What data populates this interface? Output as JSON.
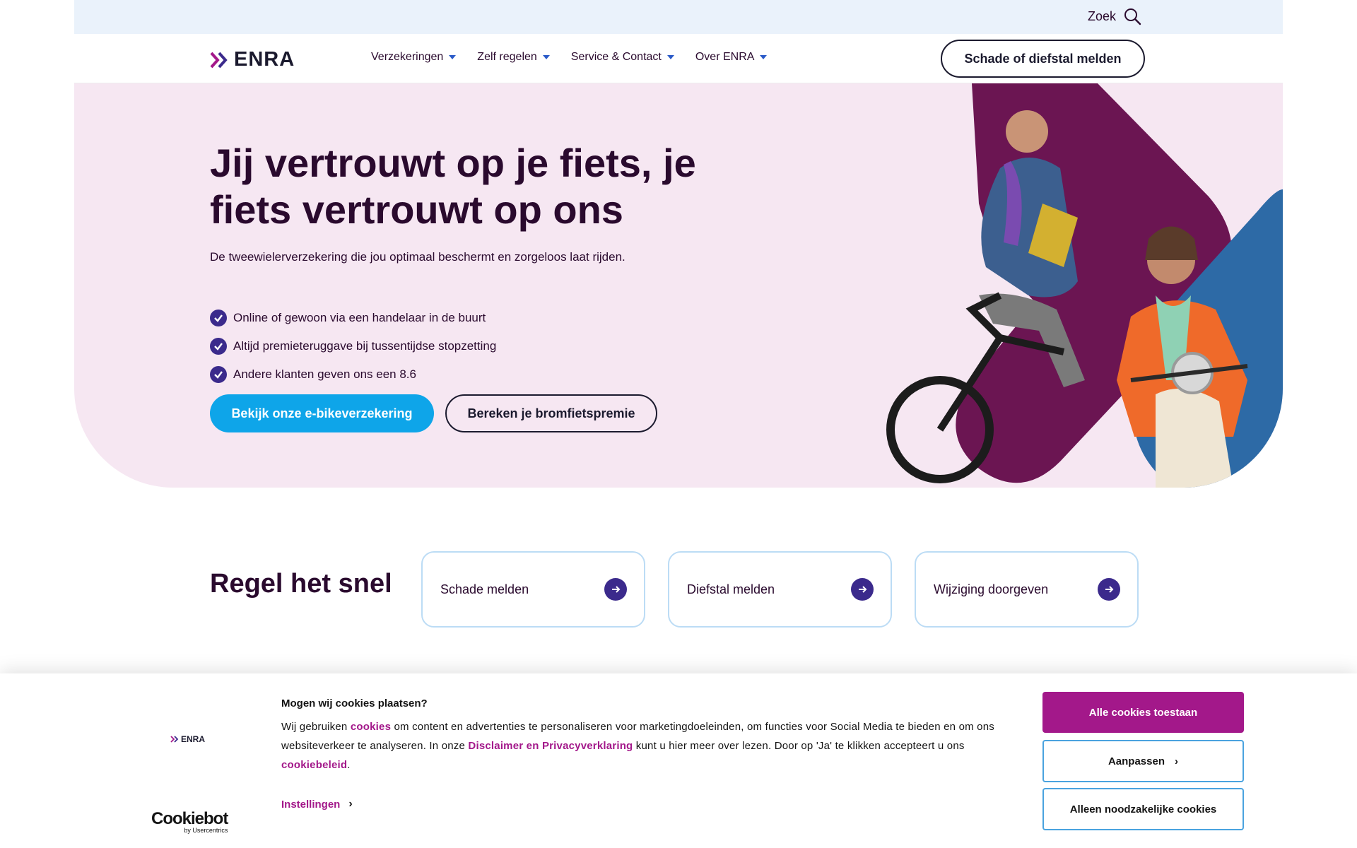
{
  "topbar": {
    "search_label": "Zoek"
  },
  "header": {
    "logo_text": "ENRA",
    "nav": [
      {
        "label": "Verzekeringen"
      },
      {
        "label": "Zelf regelen"
      },
      {
        "label": "Service & Contact"
      },
      {
        "label": "Over ENRA"
      }
    ],
    "report_button": "Schade of diefstal melden"
  },
  "hero": {
    "title": "Jij vertrouwt op je fiets, je fiets vertrouwt op ons",
    "subtitle": "De tweewielerverzekering die jou optimaal beschermt en zorgeloos laat rijden.",
    "benefits": [
      "Online of gewoon via een handelaar in de buurt",
      "Altijd premieteruggave bij tussentijdse stopzetting",
      "Andere klanten geven ons een 8.6"
    ],
    "primary_cta": "Bekijk onze e-bikeverzekering",
    "secondary_cta": "Bereken je bromfietspremie"
  },
  "quick": {
    "title": "Regel het snel",
    "cards": [
      {
        "label": "Schade melden"
      },
      {
        "label": "Diefstal melden"
      },
      {
        "label": "Wijziging doorgeven"
      }
    ]
  },
  "cookie": {
    "logo_text": "ENRA",
    "provider": "Cookiebot",
    "provider_by": "by Usercentrics",
    "heading": "Mogen wij cookies plaatsen?",
    "text_1": "Wij gebruiken ",
    "link_cookies": "cookies",
    "text_2": " om content en advertenties te personaliseren voor marketingdoeleinden, om functies voor Social Media te bieden en om ons websiteverkeer te analyseren. In onze ",
    "link_disclaimer": "Disclaimer en Privacyverklaring",
    "text_3": " kunt u hier meer over lezen. Door op 'Ja' te klikken accepteert u ons ",
    "link_policy": "cookiebeleid",
    "text_4": ".",
    "settings_label": "Instellingen",
    "allow_all": "Alle cookies toestaan",
    "customize": "Aanpassen",
    "necessary_only": "Alleen noodzakelijke cookies"
  },
  "colors": {
    "brand_purple": "#a3188a",
    "accent_blue": "#0ea5e9",
    "hero_bg": "#f6e7f2",
    "topbar_bg": "#eaf2fb",
    "dark_text": "#2a0a2e",
    "check_purple": "#3b2a8c"
  },
  "icons": {
    "search": "search-icon",
    "check": "check-circle-icon",
    "arrow": "arrow-right-circle-icon",
    "caret": "caret-down-icon"
  }
}
